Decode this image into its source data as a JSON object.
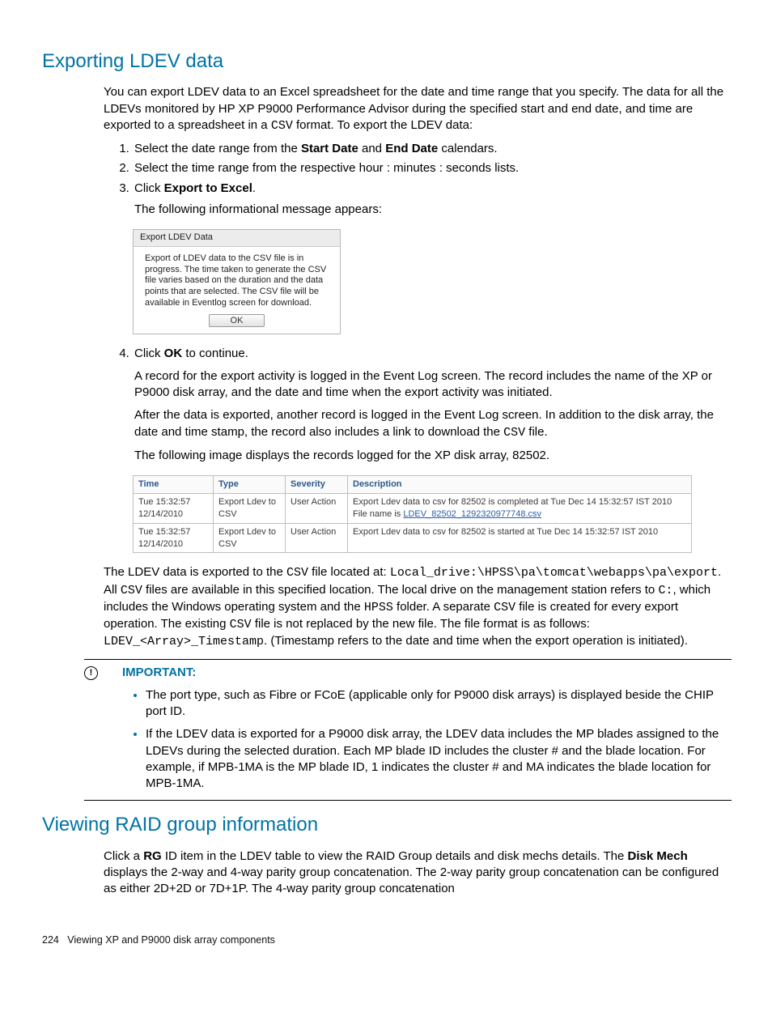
{
  "section1": {
    "title": "Exporting LDEV data",
    "p1a": "You can export LDEV data to an Excel spreadsheet for the date and time range that you specify. The data for all the LDEVs monitored by HP XP P9000 Performance Advisor during the specified start and end date, and time are exported to a spreadsheet in a ",
    "p1_fmt": "CSV",
    "p1b": " format. To export the LDEV data:",
    "steps": {
      "s1a": "Select the date range from the ",
      "s1b": "Start Date",
      "s1c": " and ",
      "s1d": "End Date",
      "s1e": " calendars.",
      "s2": "Select the time range from the respective hour : minutes : seconds lists.",
      "s3a": "Click ",
      "s3b": "Export to Excel",
      "s3c": ".",
      "s3_follow": "The following informational message appears:",
      "s4a": "Click ",
      "s4b": "OK",
      "s4c": " to continue.",
      "s4_p1": "A record for the export activity is logged in the Event Log screen. The record includes the name of the XP or P9000 disk array, and the date and time when the export activity was initiated.",
      "s4_p2a": "After the data is exported, another record is logged in the Event Log screen. In addition to the disk array, the date and time stamp, the record also includes a link to download the ",
      "s4_p2_fmt": "CSV",
      "s4_p2b": " file.",
      "s4_p3": "The following image displays the records logged for the XP disk array, 82502."
    },
    "dialog": {
      "title": "Export LDEV Data",
      "body": "Export of LDEV data to the CSV file is in progress. The time taken to generate the CSV file varies based on the duration and the data points that are selected. The CSV file will be available in Eventlog screen for download.",
      "ok": "OK"
    },
    "eventlog": {
      "h": {
        "time": "Time",
        "type": "Type",
        "sev": "Severity",
        "desc": "Description"
      },
      "rows": [
        {
          "time": "Tue 15:32:57 12/14/2010",
          "type": "Export Ldev to CSV",
          "sev": "User Action",
          "desc_a": "Export Ldev data to csv for 82502 is completed at Tue Dec 14 15:32:57 IST 2010 File name is ",
          "desc_link": "LDEV_82502_1292320977748.csv"
        },
        {
          "time": "Tue 15:32:57 12/14/2010",
          "type": "Export Ldev to CSV",
          "sev": "User Action",
          "desc_a": "Export Ldev data to csv for 82502 is started at Tue Dec 14 15:32:57 IST 2010",
          "desc_link": ""
        }
      ]
    },
    "after": {
      "a": "The LDEV data is exported to the ",
      "fmt1": "CSV",
      "b": " file located at: ",
      "fmt2": "Local_drive:\\HPSS\\pa\\tomcat\\webapps\\pa\\export",
      "c": ". All ",
      "fmt3": "CSV",
      "d": " files are available in this specified location. The local drive on the management station refers to ",
      "fmt4": "C:",
      "e": ", which includes the Windows operating system and the ",
      "fmt5": "HPSS",
      "f": " folder. A separate ",
      "fmt6": "CSV",
      "g": " file is created for every export operation. The existing ",
      "fmt7": "CSV",
      "h": " file is not replaced by the new file. The file format is as follows: ",
      "fmt8": "LDEV_<Array>_Timestamp",
      "i": ". (Timestamp refers to the date and time when the export operation is initiated)."
    }
  },
  "important": {
    "label": "IMPORTANT:",
    "b1": "The port type, such as Fibre or FCoE (applicable only for P9000 disk arrays) is displayed beside the CHIP port ID.",
    "b2": "If the LDEV data is exported for a P9000 disk array, the LDEV data includes the MP blades assigned to the LDEVs during the selected duration. Each MP blade ID includes the cluster # and the blade location. For example, if MPB-1MA is the MP blade ID, 1 indicates the cluster # and MA indicates the blade location for MPB-1MA."
  },
  "section2": {
    "title": "Viewing RAID group information",
    "p_a": "Click a ",
    "p_b": "RG",
    "p_c": " ID item in the LDEV table to view the RAID Group details and disk mechs details. The ",
    "p_d": "Disk Mech",
    "p_e": " displays the 2-way and 4-way parity group concatenation. The 2-way parity group concatenation can be configured as either 2D+2D or 7D+1P. The 4-way parity group concatenation"
  },
  "footer": {
    "page": "224",
    "title": "Viewing XP and P9000 disk array components"
  }
}
